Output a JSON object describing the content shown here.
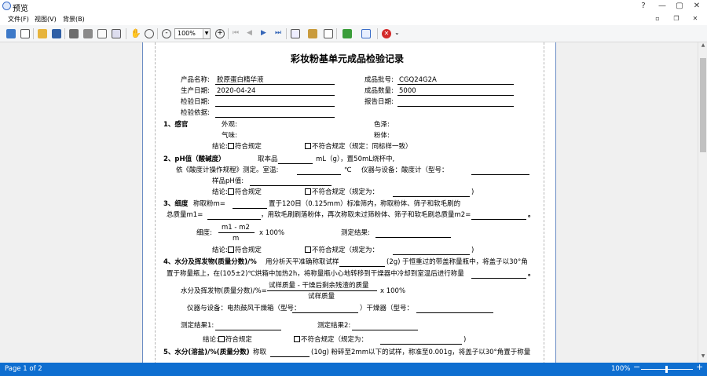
{
  "window": {
    "title": "预览"
  },
  "menu": [
    "文件(F)",
    "视图(V)",
    "背景(B)"
  ],
  "toolbar": {
    "zoom": "100%"
  },
  "doc": {
    "title": "彩妆粉基单元成品检验记录",
    "product_name_label": "产品名称:",
    "product_name": "胶原蛋白精华液",
    "batch_label": "成品批号:",
    "batch": "CGQ24G2A",
    "prod_date_label": "生产日期:",
    "prod_date": "2020-04-24",
    "qty_label": "成品数量:",
    "qty": "5000",
    "inspect_date_label": "检验日期:",
    "report_date_label": "报告日期:",
    "basis_label": "检验依据:",
    "s1": "1、感官",
    "appearance": "外观:",
    "color": "色泽:",
    "smell": "气味:",
    "powder": "粉体:",
    "c1a": "结论:",
    "conform": "符合规定",
    "c1b": "不符合规定（规定：同标样一致）",
    "s2": "2、pH值（酸碱度）",
    "s2t1": "取本品",
    "s2t2": "mL（g），置50mL烧杯中,",
    "s2l2a": "依《酸度计操作规程》测定。室温:",
    "s2l2b": "℃",
    "s2l2c": "仪器与设备：酸度计（型号：",
    "ph_label": "样品pH值:",
    "c2b": "不符合规定（规定为：",
    "close_paren": ")",
    "s3": "3、细度",
    "s3t1": "称取粉m=",
    "s3t2": "置于120目（0.125mm）标准筛内，称取粉体、筛子和软毛刷的",
    "s3l2a": "总质量m1=",
    "s3l2b": "，用软毛刷刷落粉体，再次称取未过筛粉体、筛子和软毛刷总质量m2=",
    "period": "。",
    "fineness": "细度:",
    "frac_num": "m1 - m2",
    "frac_den": "m",
    "x100": "x 100%",
    "result": "测定结果:",
    "s4": "4、水分及挥发物(质量分数)/%",
    "s4t1": "用分析天平准确称取试样",
    "s4t2": "(2g) 于恒重过的带盖称量瓶中，将盖子以30°角",
    "s4l2": "置于称量瓶上，在(105±2)℃烘箱中加热2h，将称量瓶小心地转移到干燥器中冷却到室温后进行称量",
    "s4f1": "水分及挥发物(质量分数)/%=",
    "s4num": "试样质量 - 干燥后剩余残渣的质量",
    "s4den": "试样质量",
    "equip_a": "仪器与设备：电热鼓风干燥箱（型号：",
    "equip_b": "）干燥器（型号：",
    "r1": "测定结果1:",
    "r2": "测定结果2:",
    "s5": "5、水分(溶盐)/%(质量分数)",
    "s5t1": "称取",
    "s5t2": "(10g) 粉碎至2mm以下的试样，称准至0.001g，将盖子以30°角置于称量"
  },
  "status": {
    "page": "Page 1 of 2",
    "zoom": "100%"
  }
}
